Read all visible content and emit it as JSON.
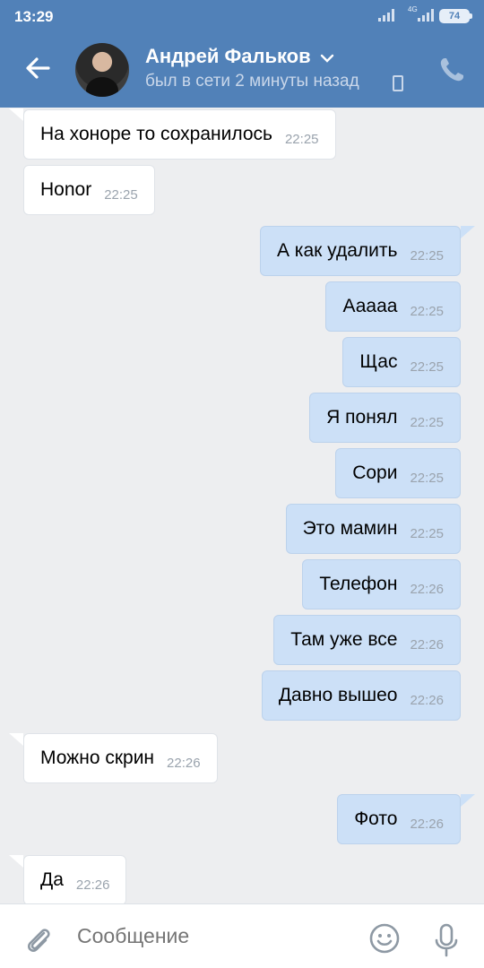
{
  "status_bar": {
    "time": "13:29",
    "network": "4G",
    "battery": "74"
  },
  "header": {
    "contact_name": "Андрей Фальков",
    "presence": "был в сети 2 минуты назад",
    "icons": [
      "back-arrow-icon",
      "chevron-down-icon",
      "mobile-phone-icon",
      "phone-call-icon"
    ],
    "accent_color": "#5181b8"
  },
  "messages": [
    {
      "dir": "in",
      "text": "На хоноре то сохранилось",
      "time": "22:25"
    },
    {
      "dir": "in",
      "text": "Honor",
      "time": "22:25"
    },
    {
      "dir": "out",
      "text": "А как удалить",
      "time": "22:25"
    },
    {
      "dir": "out",
      "text": "Ааааа",
      "time": "22:25"
    },
    {
      "dir": "out",
      "text": "Щас",
      "time": "22:25"
    },
    {
      "dir": "out",
      "text": "Я понял",
      "time": "22:25"
    },
    {
      "dir": "out",
      "text": "Сори",
      "time": "22:25"
    },
    {
      "dir": "out",
      "text": "Это мамин",
      "time": "22:25"
    },
    {
      "dir": "out",
      "text": "Телефон",
      "time": "22:26"
    },
    {
      "dir": "out",
      "text": "Там уже все",
      "time": "22:26"
    },
    {
      "dir": "out",
      "text": "Давно вышео",
      "time": "22:26"
    },
    {
      "dir": "in",
      "text": "Можно скрин",
      "time": "22:26"
    },
    {
      "dir": "out",
      "text": "Фото",
      "time": "22:26"
    },
    {
      "dir": "in",
      "text": "Да",
      "time": "22:26"
    }
  ],
  "composer": {
    "placeholder": "Сообщение",
    "icons": [
      "paperclip-icon",
      "emoji-icon",
      "microphone-icon"
    ]
  }
}
